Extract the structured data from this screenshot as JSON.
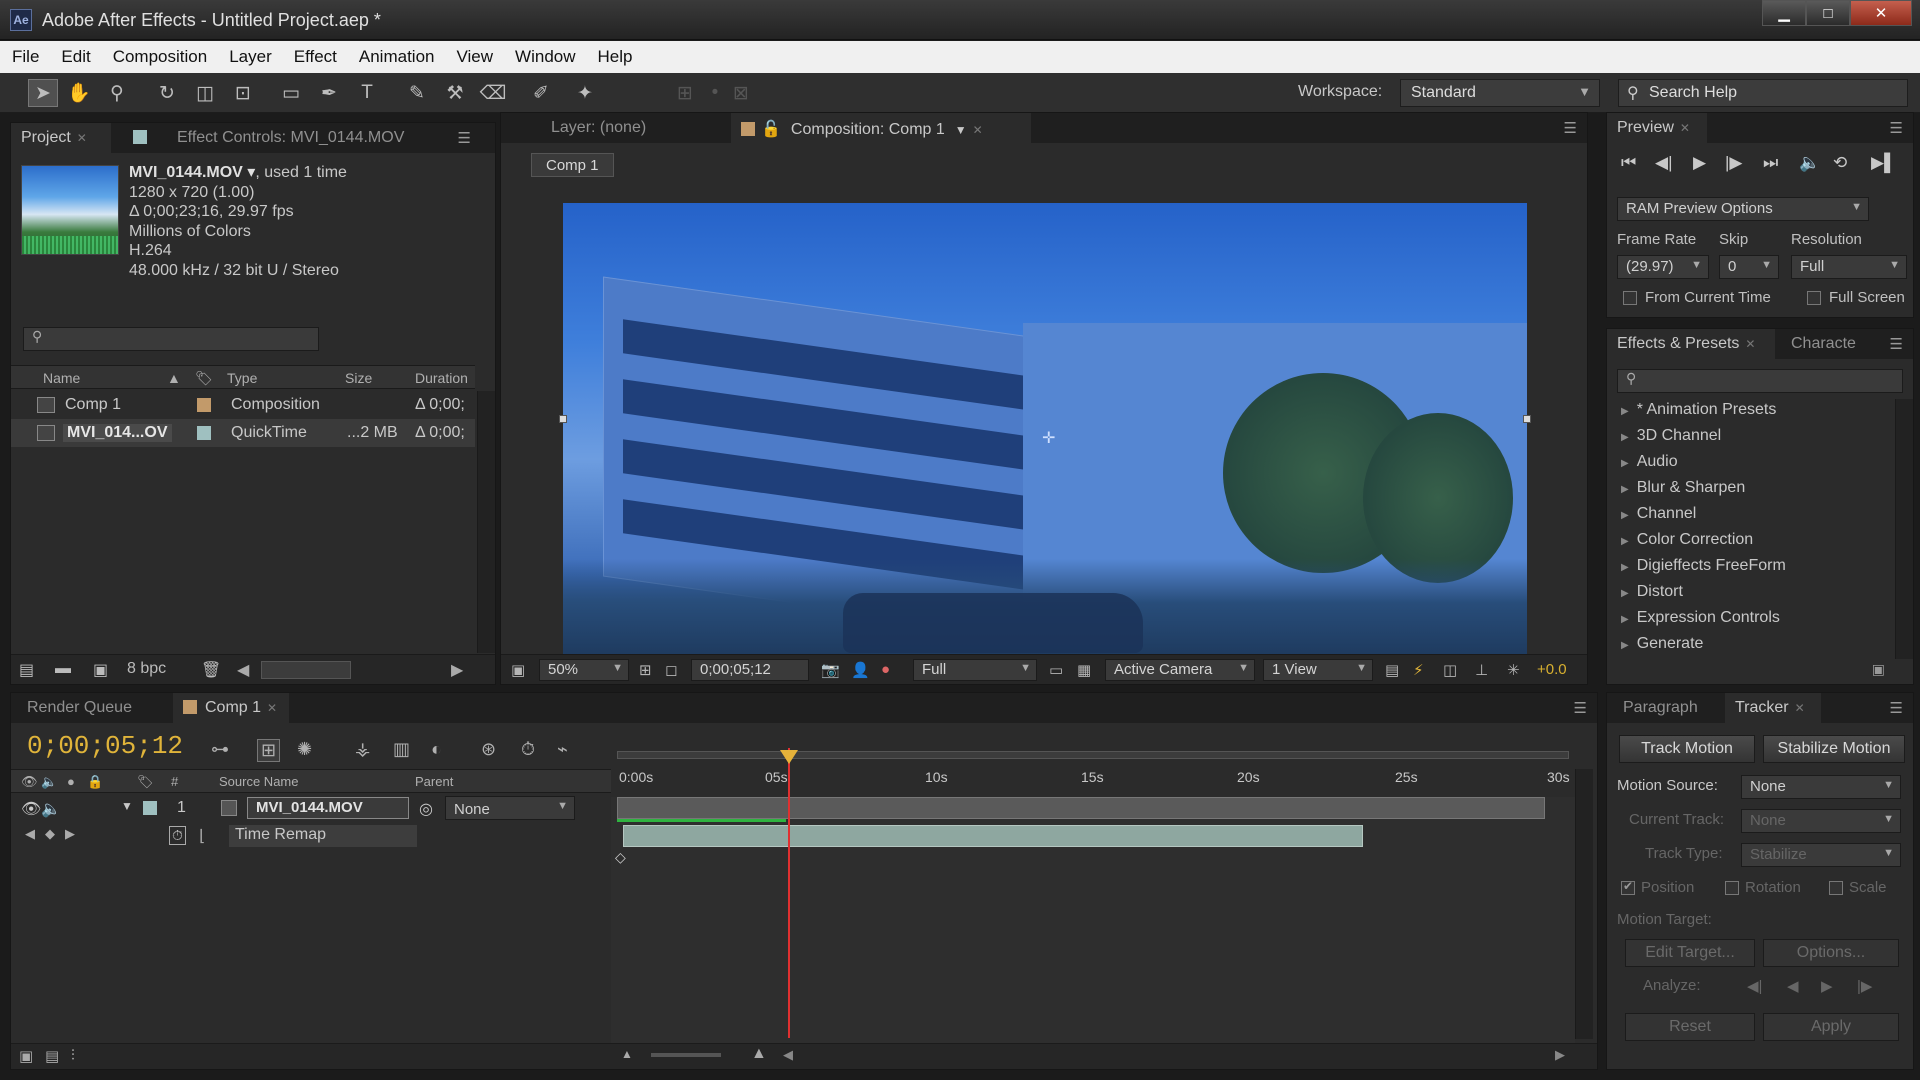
{
  "window": {
    "app_icon": "Ae",
    "title": "Adobe After Effects - Untitled Project.aep *",
    "minimize": "▁",
    "maximize": "□",
    "close": "✕"
  },
  "menu": [
    "File",
    "Edit",
    "Composition",
    "Layer",
    "Effect",
    "Animation",
    "View",
    "Window",
    "Help"
  ],
  "toolbar": {
    "workspace_label": "Workspace:",
    "workspace_value": "Standard",
    "search_placeholder": "Search Help"
  },
  "project_panel": {
    "tab_project": "Project",
    "tab_effect_controls": "Effect Controls: MVI_0144.MOV",
    "item_name": "MVI_0144.MOV ▾",
    "used": ", used 1 time",
    "line1": "1280 x 720 (1.00)",
    "line2": "Δ 0;00;23;16, 29.97 fps",
    "line3": "Millions of Colors",
    "line4": "H.264",
    "line5": "48.000 kHz / 32 bit U / Stereo",
    "columns": {
      "name": "Name",
      "type": "Type",
      "size": "Size",
      "duration": "Duration"
    },
    "rows": [
      {
        "name": "Comp 1",
        "type": "Composition",
        "size": "",
        "duration": "Δ 0;00;",
        "label_color": "#c29a6a"
      },
      {
        "name": "MVI_014...OV",
        "type": "QuickTime",
        "size": "...2 MB",
        "duration": "Δ 0;00;",
        "label_color": "#9fc0c0"
      }
    ],
    "bpc": "8 bpc"
  },
  "composition_panel": {
    "tab_layer": "Layer: (none)",
    "tab_comp": "Composition: Comp 1",
    "comp_label": "Comp 1",
    "zoom": "50%",
    "timecode": "0;00;05;12",
    "resolution": "Full",
    "camera": "Active Camera",
    "views": "1 View",
    "exposure": "+0.0"
  },
  "preview_panel": {
    "tab": "Preview",
    "ram_options": "RAM Preview Options",
    "frame_rate_label": "Frame Rate",
    "skip_label": "Skip",
    "resolution_label": "Resolution",
    "frame_rate": "(29.97)",
    "skip": "0",
    "resolution": "Full",
    "from_current": "From Current Time",
    "full_screen": "Full Screen"
  },
  "effects_panel": {
    "tab": "Effects & Presets",
    "tab2": "Characte",
    "items": [
      "* Animation Presets",
      "3D Channel",
      "Audio",
      "Blur & Sharpen",
      "Channel",
      "Color Correction",
      "Digieffects FreeForm",
      "Distort",
      "Expression Controls",
      "Generate"
    ]
  },
  "timeline": {
    "tab_render": "Render Queue",
    "tab_comp": "Comp 1",
    "timecode": "0;00;05;12",
    "col_hash": "#",
    "col_source": "Source Name",
    "col_parent": "Parent",
    "layer_number": "1",
    "layer_name": "MVI_0144.MOV",
    "parent": "None",
    "property": "Time Remap",
    "ruler": [
      "0:00s",
      "05s",
      "10s",
      "15s",
      "20s",
      "25s",
      "30s"
    ]
  },
  "tracker_panel": {
    "tab_paragraph": "Paragraph",
    "tab_tracker": "Tracker",
    "track_motion": "Track Motion",
    "stabilize_motion": "Stabilize Motion",
    "motion_source_label": "Motion Source:",
    "motion_source": "None",
    "current_track_label": "Current Track:",
    "current_track": "None",
    "track_type_label": "Track Type:",
    "track_type": "Stabilize",
    "position": "Position",
    "rotation": "Rotation",
    "scale": "Scale",
    "motion_target_label": "Motion Target:",
    "edit_target": "Edit Target...",
    "options": "Options...",
    "analyze_label": "Analyze:",
    "reset": "Reset",
    "apply": "Apply"
  }
}
